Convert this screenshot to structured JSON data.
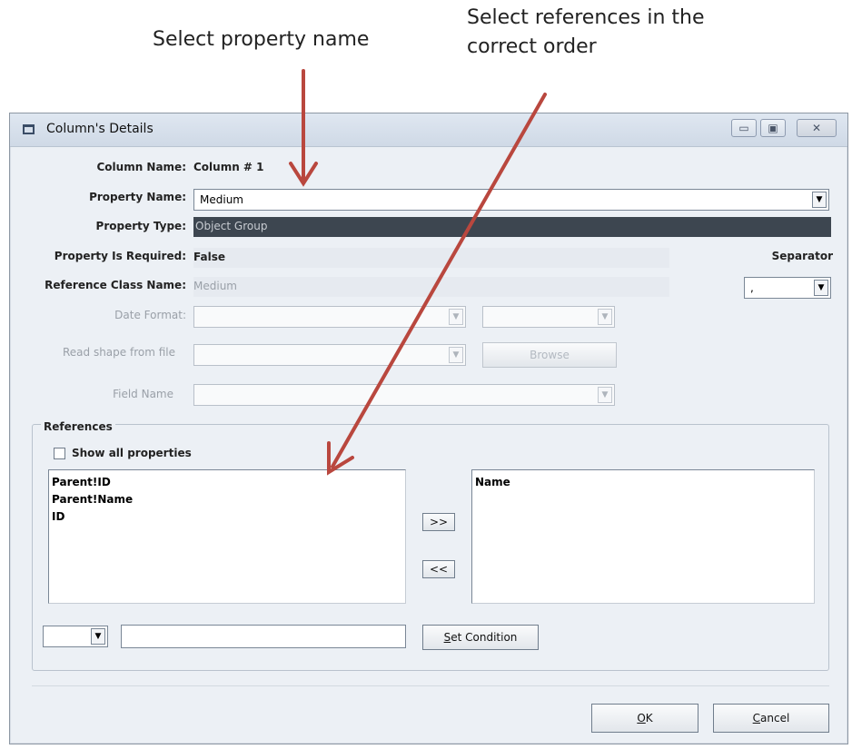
{
  "annotations": {
    "left_text": "Select property  name",
    "right_text_line1": "Select references in the",
    "right_text_line2": "correct order",
    "arrow_color": "#b9473e"
  },
  "window": {
    "title": "Column's Details",
    "buttons": {
      "minimize": "▭",
      "maximize": "▣",
      "close": "✕"
    }
  },
  "form": {
    "column_name_label": "Column Name:",
    "column_name_value": "Column # 1",
    "property_name_label": "Property Name:",
    "property_name_value": "Medium",
    "property_type_label": "Property Type:",
    "property_type_value": "Object Group",
    "required_label": "Property Is Required:",
    "required_value": "False",
    "ref_class_label": "Reference Class Name:",
    "ref_class_value": "Medium",
    "separator_label": "Separator",
    "separator_value": ",",
    "date_format_label": "Date Format:",
    "read_shape_label": "Read shape from file",
    "browse_label": "Browse",
    "field_name_label": "Field Name"
  },
  "references": {
    "legend": "References",
    "show_all_label": "Show all properties",
    "available": [
      "Parent!ID",
      "Parent!Name",
      "ID"
    ],
    "selected": [
      "Name"
    ],
    "add_button": ">>",
    "remove_button": "<<",
    "set_condition_prefix": "S",
    "set_condition_rest": "et Condition"
  },
  "footer": {
    "ok_prefix": "O",
    "ok_rest": "K",
    "cancel_prefix": "C",
    "cancel_rest": "ancel"
  },
  "colors": {
    "property_type_bar": "#3d4650",
    "property_type_text": "#c8ccd2",
    "window_bg": "#ecf0f5"
  }
}
